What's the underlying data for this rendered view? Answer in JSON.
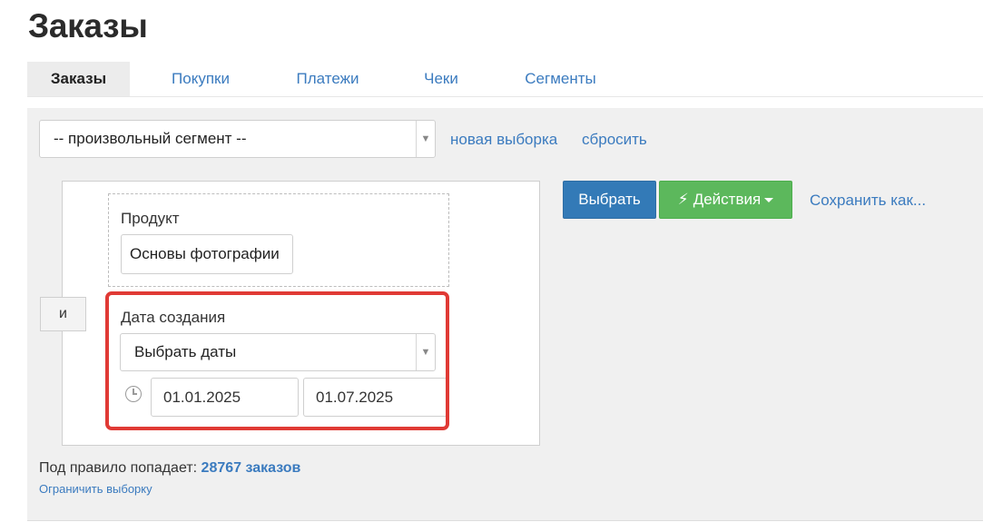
{
  "page": {
    "title": "Заказы"
  },
  "tabs": [
    {
      "label": "Заказы",
      "active": true
    },
    {
      "label": "Покупки",
      "active": false
    },
    {
      "label": "Платежи",
      "active": false
    },
    {
      "label": "Чеки",
      "active": false
    },
    {
      "label": "Сегменты",
      "active": false
    }
  ],
  "segment": {
    "selected": "-- произвольный сегмент --",
    "new_selection_label": "новая выборка",
    "reset_label": "сбросить"
  },
  "rule": {
    "and_label": "и",
    "product": {
      "label": "Продукт",
      "value": "Основы фотографии"
    },
    "created_date": {
      "label": "Дата создания",
      "mode": "Выбрать даты",
      "date_from": "01.01.2025",
      "date_to": "01.07.2025"
    }
  },
  "actions": {
    "select_label": "Выбрать",
    "actions_label": "Действия",
    "save_as_label": "Сохранить как..."
  },
  "summary": {
    "prefix": "Под правило попадает:",
    "count_text": "28767 заказов",
    "limit_label": "Ограничить выборку"
  },
  "colors": {
    "link": "#3b7bbf",
    "primary": "#337ab7",
    "success": "#5cb85c",
    "highlight": "#e03a35"
  }
}
